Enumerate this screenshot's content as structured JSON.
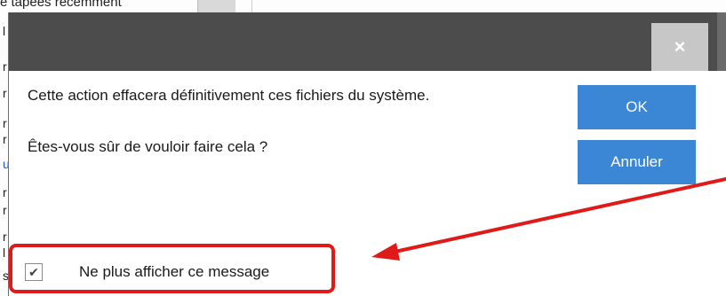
{
  "background": {
    "top_text": "é tapees récemment",
    "letters": [
      {
        "char": "l",
        "blue": false
      },
      {
        "char": "r",
        "blue": false
      },
      {
        "char": "r",
        "blue": false
      },
      {
        "char": "r",
        "blue": false
      },
      {
        "char": "r",
        "blue": false
      },
      {
        "char": "u",
        "blue": true
      },
      {
        "char": "r",
        "blue": false
      },
      {
        "char": "r",
        "blue": false
      },
      {
        "char": "r",
        "blue": false
      },
      {
        "char": "l",
        "blue": false
      },
      {
        "char": "s",
        "blue": false
      }
    ]
  },
  "dialog": {
    "title": "",
    "close_symbol": "×",
    "message_line1": "Cette action effacera définitivement ces fichiers du système.",
    "message_line2": "Êtes-vous sûr de vouloir faire cela ?",
    "ok_label": "OK",
    "cancel_label": "Annuler",
    "checkbox_label": "Ne plus afficher ce message",
    "checkbox_checked": true,
    "checkmark": "✔"
  },
  "annotation": {
    "color": "#e01919"
  },
  "colors": {
    "titlebar": "#4c4c4c",
    "button": "#3c86d6",
    "close_button": "#c7c7c7"
  }
}
